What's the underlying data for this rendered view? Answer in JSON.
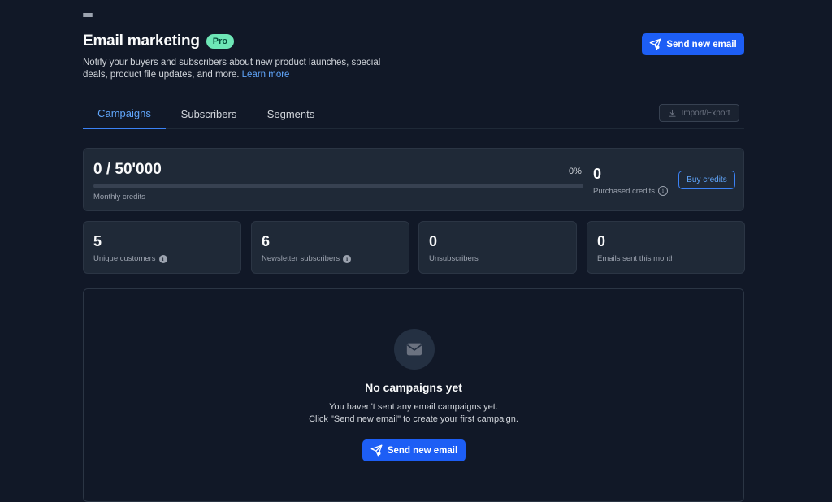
{
  "page": {
    "title": "Email marketing",
    "badge": "Pro",
    "subtitle": "Notify your buyers and subscribers about new product launches, special deals, product file updates, and more.",
    "learn_more": "Learn more",
    "send_button": "Send new email"
  },
  "tabs": [
    {
      "label": "Campaigns",
      "active": true
    },
    {
      "label": "Subscribers",
      "active": false
    },
    {
      "label": "Segments",
      "active": false
    }
  ],
  "import_export": "Import/Export",
  "credits": {
    "monthly_value": "0 / 50'000",
    "monthly_label": "Monthly credits",
    "percent": "0%",
    "progress_fraction": 0,
    "purchased_value": "0",
    "purchased_label": "Purchased credits",
    "buy_button": "Buy credits"
  },
  "stats": [
    {
      "value": "5",
      "label": "Unique customers",
      "info": true
    },
    {
      "value": "6",
      "label": "Newsletter subscribers",
      "info": true
    },
    {
      "value": "0",
      "label": "Unsubscribers",
      "info": false
    },
    {
      "value": "0",
      "label": "Emails sent this month",
      "info": false
    }
  ],
  "empty_state": {
    "title": "No campaigns yet",
    "line1": "You haven't sent any email campaigns yet.",
    "line2": "Click \"Send new email\" to create your first campaign.",
    "button": "Send new email"
  },
  "icons": {
    "menu": "hamburger-icon",
    "send": "paper-plane-icon",
    "import": "download-icon",
    "info": "info-icon",
    "empty": "envelope-icon"
  },
  "colors": {
    "background": "#111827",
    "card": "#1f2937",
    "accent": "#1d5ef5",
    "link": "#60a5fa",
    "badge": "#6ee7b7"
  }
}
